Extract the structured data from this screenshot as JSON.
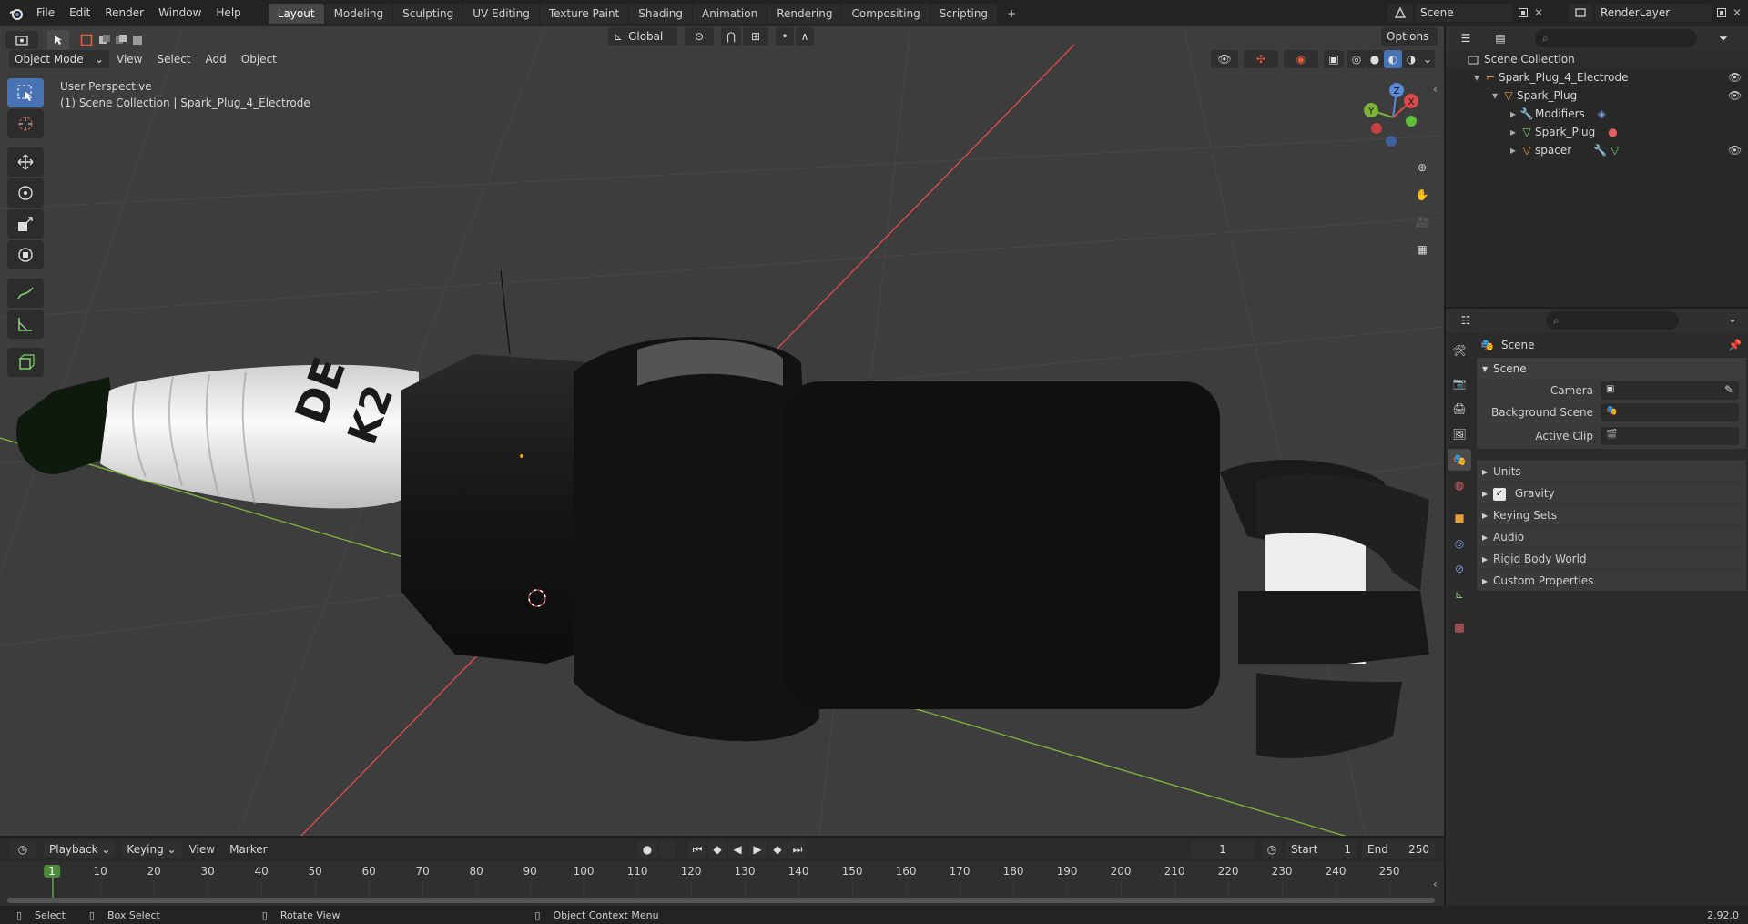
{
  "app": {
    "menus": [
      "File",
      "Edit",
      "Render",
      "Window",
      "Help"
    ],
    "workspace_tabs": [
      "Layout",
      "Modeling",
      "Sculpting",
      "UV Editing",
      "Texture Paint",
      "Shading",
      "Animation",
      "Rendering",
      "Compositing",
      "Scripting"
    ],
    "active_tab": "Layout",
    "scene_name": "Scene",
    "view_layer": "RenderLayer"
  },
  "viewport": {
    "mode": "Object Mode",
    "menus": [
      "View",
      "Select",
      "Add",
      "Object"
    ],
    "transform_orientation": "Global",
    "options_label": "Options",
    "perspective_label": "User Perspective",
    "collection_label": "(1) Scene Collection | Spark_Plug_4_Electrode",
    "axis_labels": {
      "x": "X",
      "y": "Y",
      "z": "Z"
    },
    "colors": {
      "background": "#3d3d3d",
      "x_axis": "#d94b4b",
      "y_axis": "#7bb33b",
      "active_tool": "#4772b3"
    }
  },
  "tools": [
    "select-box-icon",
    "cursor-icon",
    "move-icon",
    "rotate-icon",
    "scale-icon",
    "transform-icon",
    "annotate-icon",
    "measure-icon",
    "add-cube-icon"
  ],
  "outliner": {
    "root": "Scene Collection",
    "items": [
      {
        "label": "Spark_Plug_4_Electrode",
        "depth": 1
      },
      {
        "label": "Spark_Plug",
        "depth": 2
      },
      {
        "label": "Modifiers",
        "depth": 3
      },
      {
        "label": "Spark_Plug",
        "depth": 3
      },
      {
        "label": "spacer",
        "depth": 3
      }
    ]
  },
  "properties": {
    "context": "Scene",
    "panel": "Scene",
    "fields": {
      "camera": "Camera",
      "background_scene": "Background Scene",
      "active_clip": "Active Clip"
    },
    "subpanels": [
      "Units",
      "Gravity",
      "Keying Sets",
      "Audio",
      "Rigid Body World",
      "Custom Properties"
    ],
    "gravity_checked": true
  },
  "timeline": {
    "menus": [
      "Playback",
      "Keying",
      "View",
      "Marker"
    ],
    "current_frame": "1",
    "start_label": "Start",
    "start": "1",
    "end_label": "End",
    "end": "250",
    "ticks": [
      "1",
      "10",
      "20",
      "30",
      "40",
      "50",
      "60",
      "70",
      "80",
      "90",
      "100",
      "110",
      "120",
      "130",
      "140",
      "150",
      "160",
      "170",
      "180",
      "190",
      "200",
      "210",
      "220",
      "230",
      "240",
      "250"
    ]
  },
  "statusbar": {
    "select": "Select",
    "box_select": "Box Select",
    "rotate": "Rotate View",
    "context_menu": "Object Context Menu",
    "version": "2.92.0"
  },
  "decal": {
    "line1": "DE",
    "line2": "K2"
  }
}
